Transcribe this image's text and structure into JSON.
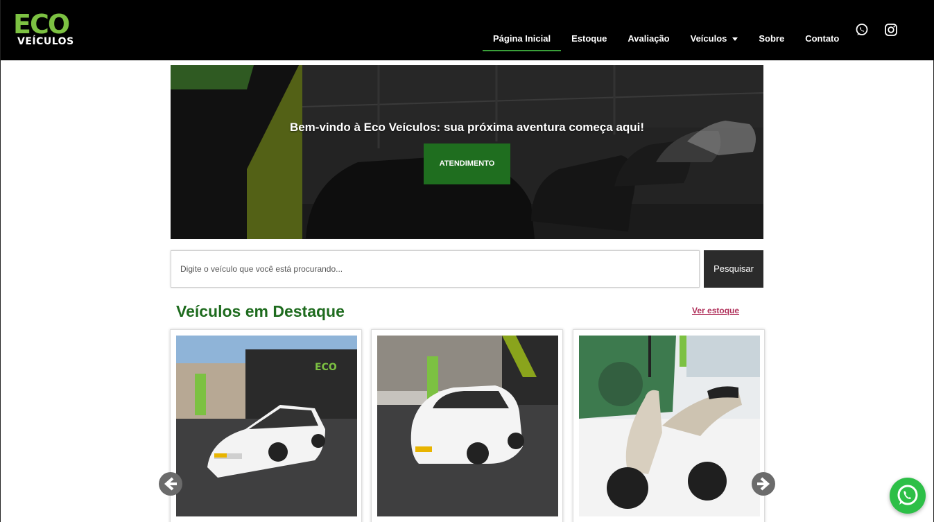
{
  "brand": {
    "logo_main": "ECO",
    "logo_sub": "VEÍCULOS",
    "accent": "#7cc142",
    "dark_green": "#1f6e1f"
  },
  "nav": {
    "items": [
      {
        "label": "Página Inicial",
        "active": true
      },
      {
        "label": "Estoque"
      },
      {
        "label": "Avaliação"
      },
      {
        "label": "Veículos",
        "has_dropdown": true
      },
      {
        "label": "Sobre"
      },
      {
        "label": "Contato"
      }
    ],
    "social": [
      "whatsapp-icon",
      "instagram-icon"
    ]
  },
  "hero": {
    "title": "Bem-vindo à Eco Veículos: sua próxima aventura começa aqui!",
    "button_label": "ATENDIMENTO"
  },
  "search": {
    "placeholder": "Digite o veículo que você está procurando...",
    "button_label": "Pesquisar"
  },
  "featured": {
    "title": "Veículos em Destaque",
    "link_label": "Ver estoque",
    "cards": [
      {
        "image": "white sedan in front of Eco Veículos store"
      },
      {
        "image": "white compact SUV in front of Eco Veículos store"
      },
      {
        "image": "beige scooter motorcycle inside showroom"
      }
    ]
  },
  "floating": {
    "icon": "whatsapp-icon",
    "color": "#2dbf47"
  }
}
